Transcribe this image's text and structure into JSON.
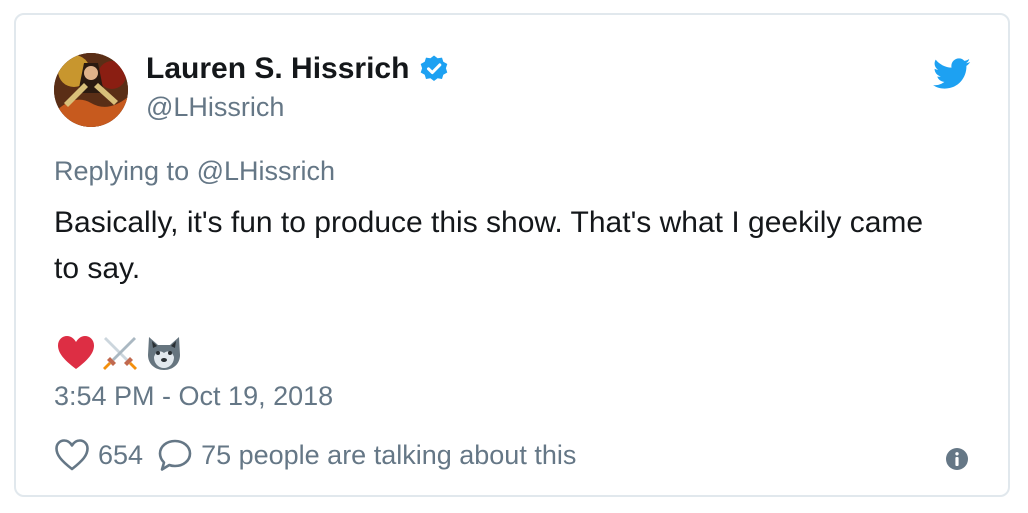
{
  "tweet": {
    "author_name": "Lauren S. Hissrich",
    "handle": "@LHissrich",
    "reply_prefix": "Replying to",
    "reply_to": "@LHissrich",
    "text": "Basically, it's fun to produce this show. That's what I geekily came to say.",
    "emojis": [
      "heart-emoji",
      "crossed-swords-emoji",
      "wolf-emoji"
    ],
    "timestamp": "3:54 PM - Oct 19, 2018",
    "like_count": "654",
    "talking_text": "75 people are talking about this"
  },
  "colors": {
    "text": "#14171a",
    "secondary": "#657786",
    "twitter_blue": "#1da1f2",
    "border": "#e1e8ed",
    "heart_red": "#dd2e44"
  },
  "icons": {
    "verified": "verified-badge-icon",
    "logo": "twitter-bird-icon",
    "like": "heart-outline-icon",
    "reply": "speech-bubble-icon",
    "info": "info-icon"
  }
}
